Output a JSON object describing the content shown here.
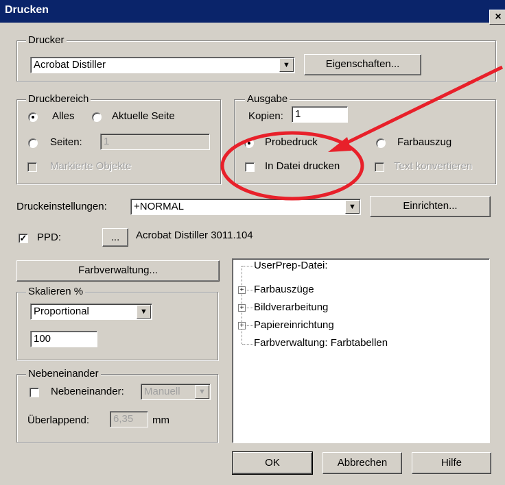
{
  "window": {
    "title": "Drucken",
    "close_symbol": "×"
  },
  "drucker": {
    "legend": "Drucker",
    "selected_printer": "Acrobat Distiller",
    "properties_button": "Eigenschaften..."
  },
  "druckbereich": {
    "legend": "Druckbereich",
    "all_label": "Alles",
    "current_page_label": "Aktuelle Seite",
    "pages_label": "Seiten:",
    "pages_value": "1",
    "marked_objects_label": "Markierte Objekte",
    "selected": "Alles"
  },
  "ausgabe": {
    "legend": "Ausgabe",
    "copies_label": "Kopien:",
    "copies_value": "1",
    "proof_label": "Probedruck",
    "separations_label": "Farbauszug",
    "print_to_file_label": "In Datei drucken",
    "convert_text_label": "Text konvertieren",
    "selected": "Probedruck",
    "print_to_file_checked": false
  },
  "druckeinstellungen": {
    "label": "Druckeinstellungen:",
    "value": "+NORMAL",
    "setup_button": "Einrichten..."
  },
  "ppd": {
    "label": "PPD:",
    "checked": true,
    "browse_button": "...",
    "value": "Acrobat Distiller 3011.104"
  },
  "farbverwaltung_button": "Farbverwaltung...",
  "skalieren": {
    "legend": "Skalieren %",
    "mode": "Proportional",
    "value": "100"
  },
  "nebeneinander": {
    "legend": "Nebeneinander",
    "checkbox_label": "Nebeneinander:",
    "mode": "Manuell",
    "overlap_label": "Überlappend:",
    "overlap_value": "6,35",
    "overlap_unit": "mm"
  },
  "tree": {
    "items": [
      {
        "label": "UserPrep-Datei:",
        "expandable": false
      },
      {
        "label": "Farbauszüge",
        "expandable": true
      },
      {
        "label": "Bildverarbeitung",
        "expandable": true
      },
      {
        "label": "Papiereinrichtung",
        "expandable": true
      },
      {
        "label": "Farbverwaltung: Farbtabellen",
        "expandable": false
      }
    ]
  },
  "buttons": {
    "ok": "OK",
    "cancel": "Abbrechen",
    "help": "Hilfe"
  },
  "annotation": {
    "color": "#e8202a"
  }
}
